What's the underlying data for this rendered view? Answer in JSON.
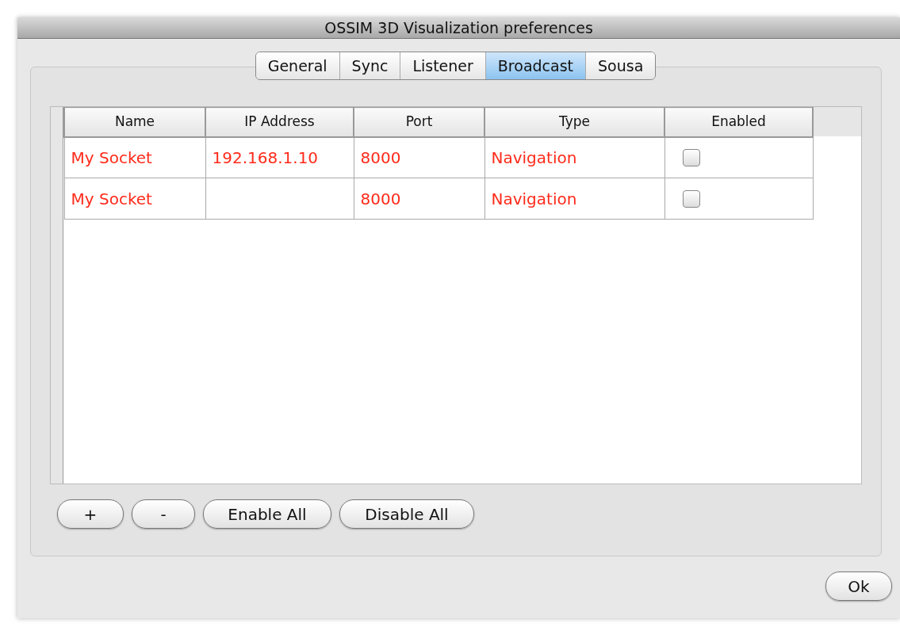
{
  "window": {
    "title": "OSSIM 3D Visualization preferences"
  },
  "tabs": [
    {
      "label": "General",
      "selected": false
    },
    {
      "label": "Sync",
      "selected": false
    },
    {
      "label": "Listener",
      "selected": false
    },
    {
      "label": "Broadcast",
      "selected": true
    },
    {
      "label": "Sousa",
      "selected": false
    }
  ],
  "table": {
    "columns": [
      "Name",
      "IP Address",
      "Port",
      "Type",
      "Enabled"
    ],
    "rows": [
      {
        "name": "My Socket",
        "ip_address": "192.168.1.10",
        "port": "8000",
        "type": "Navigation",
        "enabled": false
      },
      {
        "name": "My Socket",
        "port": "8000",
        "type": "Navigation",
        "enabled": false
      }
    ]
  },
  "buttons": [
    "+",
    "-",
    "Enable All",
    "Disable All"
  ],
  "ok_button": "Ok"
}
